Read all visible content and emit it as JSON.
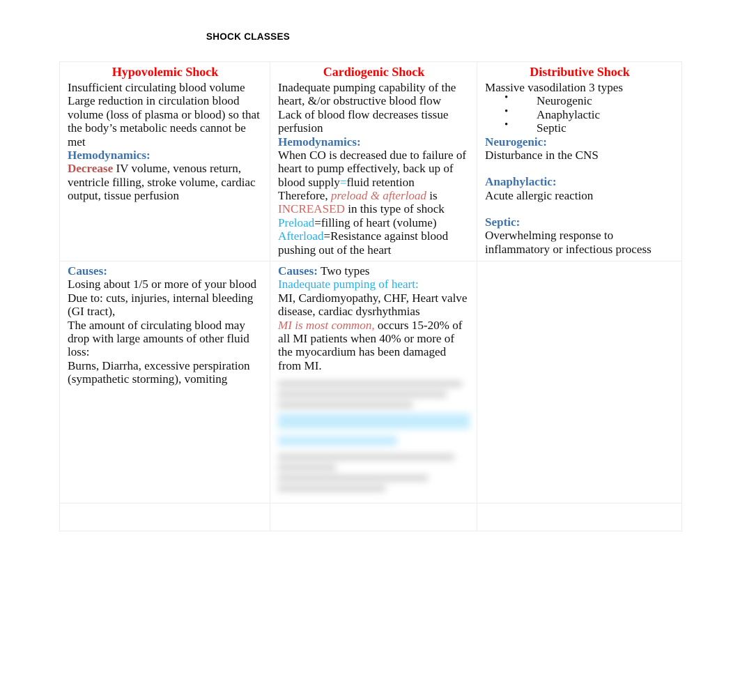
{
  "document": {
    "title": "SHOCK CLASSES"
  },
  "table": {
    "columns": [
      {
        "heading": "Hypovolemic Shock"
      },
      {
        "heading": "Cardiogenic Shock"
      },
      {
        "heading": "Distributive Shock"
      }
    ],
    "row1": {
      "hypovolemic": {
        "intro_lines": [
          "Insufficient circulating blood volume",
          "Large reduction in circulation blood",
          "volume (loss of plasma or blood) so that",
          "the body’s metabolic needs cannot be met"
        ],
        "hemodynamics_label": "Hemodynamics:",
        "decrease_label": "Decrease",
        "decrease_rest": " IV volume, venous return, ventricle filling, stroke volume, cardiac output, tissue perfusion"
      },
      "cardiogenic": {
        "intro_lines": [
          "Inadequate pumping capability of the",
          "heart, &/or obstructive blood flow",
          "Lack of blood flow decreases tissue",
          "perfusion"
        ],
        "hemodynamics_label": "Hemodynamics:",
        "co_text_a": "When CO is decreased due to failure of heart to pump effectively, back up of blood supply",
        "co_equals": "=",
        "co_text_b": "fluid retention",
        "therefore_prefix": "Therefore, ",
        "therefore_italic": "preload & afterload",
        "therefore_mid": " is ",
        "therefore_increased": "INCREASED",
        "therefore_suffix": " in this type of shock",
        "preload_label": "Preload",
        "preload_def": "=filling of heart (volume)",
        "afterload_label": "Afterload",
        "afterload_def": "=Resistance against blood pushing out of the heart"
      },
      "distributive": {
        "intro": "Massive vasodilation   3 types",
        "types": [
          "Neurogenic",
          "Anaphylactic",
          "Septic"
        ],
        "neurogenic_label": "Neurogenic:",
        "neurogenic_text": "Disturbance in the CNS",
        "anaphylactic_label": "Anaphylactic:",
        "anaphylactic_text": "Acute allergic reaction",
        "septic_label": "Septic:",
        "septic_text": "Overwhelming response to inflammatory or infectious process"
      }
    },
    "row2": {
      "hypovolemic": {
        "causes_label": "Causes:",
        "causes_lines": [
          "Losing about 1/5 or more of your blood",
          "Due to: cuts, injuries, internal bleeding (GI tract),",
          "The amount of circulating blood may drop with large amounts of other fluid loss:",
          "Burns, Diarrha, excessive perspiration (sympathetic storming), vomiting"
        ]
      },
      "cardiogenic": {
        "causes_label": "Causes:",
        "causes_suffix": "   Two types",
        "subhead": "Inadequate pumping of heart:",
        "list_text": "MI, Cardiomyopathy, CHF, Heart valve disease, cardiac dysrhythmias",
        "mi_italic": "MI is most common,",
        "mi_rest": " occurs 15-20% of all MI patients when 40% or more of the myocardium has been damaged from MI."
      },
      "distributive": {
        "content": ""
      }
    },
    "row3": {
      "hypovolemic": {
        "content": ""
      },
      "cardiogenic": {
        "content": ""
      },
      "distributive": {
        "content": ""
      }
    }
  },
  "colors": {
    "heading_red": "#fe0000",
    "subhead_blue": "#3f72ad",
    "accent_cyan": "#23b0ef",
    "accent_red": "#c0504d",
    "highlight_cyan": "#9fe0fb",
    "border_gray": "#ececec"
  }
}
